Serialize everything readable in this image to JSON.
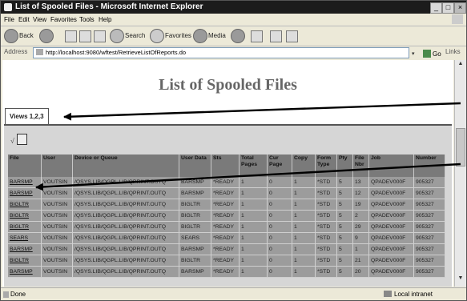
{
  "window": {
    "title": "List of Spooled Files - Microsoft Internet Explorer",
    "buttons": {
      "minimize": "_",
      "maximize": "□",
      "close": "×"
    }
  },
  "menu": [
    "File",
    "Edit",
    "View",
    "Favorites",
    "Tools",
    "Help"
  ],
  "toolbar": {
    "back": "Back",
    "search": "Search",
    "favorites": "Favorites",
    "media": "Media"
  },
  "address": {
    "label": "Address",
    "url": "http://localhost:9080/wftest/RetrieveListOfReports.do",
    "go": "Go",
    "links": "Links"
  },
  "page": {
    "title": "List of Spooled Files",
    "tab": "Views 1,2,3"
  },
  "table": {
    "headers": [
      "File",
      "User",
      "Device or Queue",
      "User Data",
      "Sts",
      "Total Pages",
      "Cur Page",
      "Copy",
      "Form Type",
      "Pty",
      "File Nbr",
      "Job",
      "Number"
    ],
    "rows": [
      [
        "BARSMP",
        "VOUTSIN",
        "/QSYS.LIB/QGPL.LIB/QPRINT.OUTQ",
        "BARSMP",
        "*READY",
        "1",
        "0",
        "1",
        "*STD",
        "5",
        "13",
        "QPADEV000F",
        "905327"
      ],
      [
        "BARSMP",
        "VOUTSIN",
        "/QSYS.LIB/QGPL.LIB/QPRINT.OUTQ",
        "BARSMP",
        "*READY",
        "1",
        "0",
        "1",
        "*STD",
        "5",
        "12",
        "QPADEV000F",
        "905327"
      ],
      [
        "BIGLTR",
        "VOUTSIN",
        "/QSYS.LIB/QGPL.LIB/QPRINT.OUTQ",
        "BIGLTR",
        "*READY",
        "1",
        "0",
        "1",
        "*STD",
        "5",
        "19",
        "QPADEV000F",
        "905327"
      ],
      [
        "BIGLTR",
        "VOUTSIN",
        "/QSYS.LIB/QGPL.LIB/QPRINT.OUTQ",
        "BIGLTR",
        "*READY",
        "1",
        "0",
        "1",
        "*STD",
        "5",
        "2",
        "QPADEV000F",
        "905327"
      ],
      [
        "BIGLTR",
        "VOUTSIN",
        "/QSYS.LIB/QGPL.LIB/QPRINT.OUTQ",
        "BIGLTR",
        "*READY",
        "1",
        "0",
        "1",
        "*STD",
        "5",
        "29",
        "QPADEV000F",
        "905327"
      ],
      [
        "SEARS",
        "VOUTSIN",
        "/QSYS.LIB/QGPL.LIB/QPRINT.OUTQ",
        "SEARS",
        "*READY",
        "1",
        "0",
        "1",
        "*STD",
        "5",
        "9",
        "QPADEV000F",
        "905327"
      ],
      [
        "BARSMP",
        "VOUTSIN",
        "/QSYS.LIB/QGPL.LIB/QPRINT.OUTQ",
        "BARSMP",
        "*READY",
        "1",
        "0",
        "1",
        "*STD",
        "5",
        "1",
        "QPADEV000F",
        "905327"
      ],
      [
        "BIGLTR",
        "VOUTSIN",
        "/QSYS.LIB/QGPL.LIB/QPRINT.OUTQ",
        "BIGLTR",
        "*READY",
        "1",
        "0",
        "1",
        "*STD",
        "5",
        "21",
        "QPADEV000F",
        "905327"
      ],
      [
        "BARSMP",
        "VOUTSIN",
        "/QSYS.LIB/QGPL.LIB/QPRINT.OUTQ",
        "BARSMP",
        "*READY",
        "1",
        "0",
        "1",
        "*STD",
        "5",
        "20",
        "QPADEV000F",
        "905327"
      ]
    ]
  },
  "status": {
    "text": "Done",
    "zone": "Local intranet"
  }
}
